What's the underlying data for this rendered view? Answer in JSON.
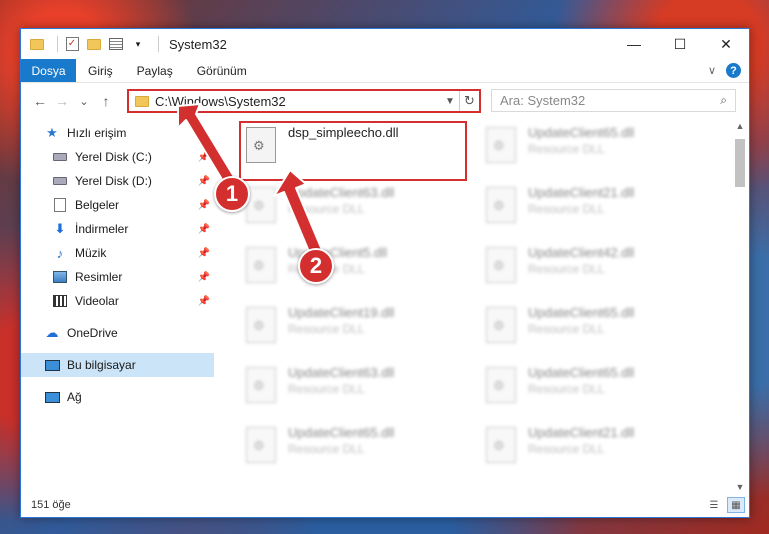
{
  "window": {
    "title": "System32",
    "controls": {
      "minimize": "—",
      "maximize": "☐",
      "close": "✕"
    }
  },
  "ribbon": {
    "tabs": [
      "Dosya",
      "Giriş",
      "Paylaş",
      "Görünüm"
    ],
    "expand_icon": "∨",
    "help_label": "?"
  },
  "nav": {
    "back": "←",
    "forward": "→",
    "recent": "⌄",
    "up": "↑",
    "address": "C:\\Windows\\System32",
    "search_placeholder": "Ara: System32"
  },
  "sidebar": {
    "items": [
      {
        "label": "Hızlı erişim",
        "icon": "star-icon"
      },
      {
        "label": "Yerel Disk (C:)",
        "icon": "drive-icon",
        "pinned": true
      },
      {
        "label": "Yerel Disk (D:)",
        "icon": "drive-icon",
        "pinned": true
      },
      {
        "label": "Belgeler",
        "icon": "document-icon",
        "pinned": true
      },
      {
        "label": "İndirmeler",
        "icon": "download-icon",
        "pinned": true
      },
      {
        "label": "Müzik",
        "icon": "music-icon",
        "pinned": true
      },
      {
        "label": "Resimler",
        "icon": "pictures-icon",
        "pinned": true
      },
      {
        "label": "Videolar",
        "icon": "videos-icon",
        "pinned": true
      },
      {
        "label": "OneDrive",
        "icon": "cloud-icon"
      },
      {
        "label": "Bu bilgisayar",
        "icon": "computer-icon",
        "selected": true
      },
      {
        "label": "Ağ",
        "icon": "network-icon"
      }
    ]
  },
  "files": [
    {
      "name": "dsp_simpleecho.dll",
      "type": ""
    },
    {
      "name": "UpdateClient65.dll",
      "type": "Resource DLL"
    },
    {
      "name": "UpdateClient63.dll",
      "type": "Resource DLL"
    },
    {
      "name": "UpdateClient21.dll",
      "type": "Resource DLL"
    },
    {
      "name": "UpdateClient5.dll",
      "type": "Resource DLL"
    },
    {
      "name": "UpdateClient42.dll",
      "type": "Resource DLL"
    },
    {
      "name": "UpdateClient19.dll",
      "type": "Resource DLL"
    },
    {
      "name": "UpdateClient65.dll",
      "type": "Resource DLL"
    },
    {
      "name": "UpdateClient63.dll",
      "type": "Resource DLL"
    },
    {
      "name": "UpdateClient65.dll",
      "type": "Resource DLL"
    },
    {
      "name": "UpdateClient65.dll",
      "type": "Resource DLL"
    },
    {
      "name": "UpdateClient21.dll",
      "type": "Resource DLL"
    }
  ],
  "status": {
    "count": "151 öğe"
  },
  "annotations": {
    "badge1": "1",
    "badge2": "2",
    "accent": "#d32f2f"
  }
}
